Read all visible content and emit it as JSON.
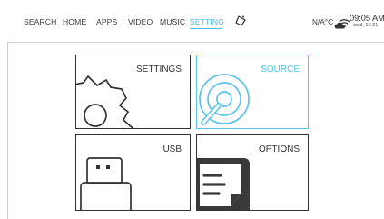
{
  "nav": {
    "items": [
      {
        "label": "SEARCH"
      },
      {
        "label": "HOME"
      },
      {
        "label": "APPS"
      },
      {
        "label": "VIDEO"
      },
      {
        "label": "MUSIC"
      },
      {
        "label": "SETTING"
      }
    ],
    "active_item": "SETTING"
  },
  "status": {
    "temperature": "N/A°C",
    "time": "09:05 AM",
    "date": "wed,  12.31",
    "icons": [
      "clean-icon",
      "weather-cloud-icon",
      "wifi-icon"
    ]
  },
  "tiles": [
    {
      "label": "SETTINGS",
      "icon": "gear-icon"
    },
    {
      "label": "SOURCE",
      "icon": "disc-icon",
      "selected": true
    },
    {
      "label": "USB",
      "icon": "usb-drive-icon"
    },
    {
      "label": "OPTIONS",
      "icon": "document-icon"
    }
  ],
  "colors": {
    "accent": "#45b9e6",
    "text": "#333333",
    "background": "#ffffff"
  }
}
